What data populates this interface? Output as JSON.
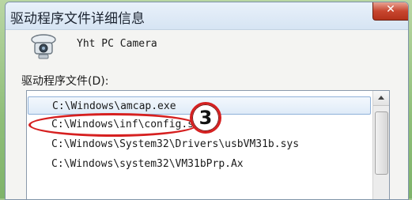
{
  "window": {
    "title": "驱动程序文件详细信息",
    "close_glyph": "✕"
  },
  "device": {
    "icon": "webcam-icon",
    "name": "Yht PC Camera"
  },
  "files_section": {
    "label": "驱动程序文件(D):",
    "files": [
      "C:\\Windows\\amcap.exe",
      "C:\\Windows\\inf\\config.set",
      "C:\\Windows\\System32\\Drivers\\usbVM31b.sys",
      "C:\\Windows\\system32\\VM31bPrp.Ax"
    ],
    "selected_index": 0
  },
  "annotation": {
    "step_number": "3",
    "color": "#d62020"
  }
}
